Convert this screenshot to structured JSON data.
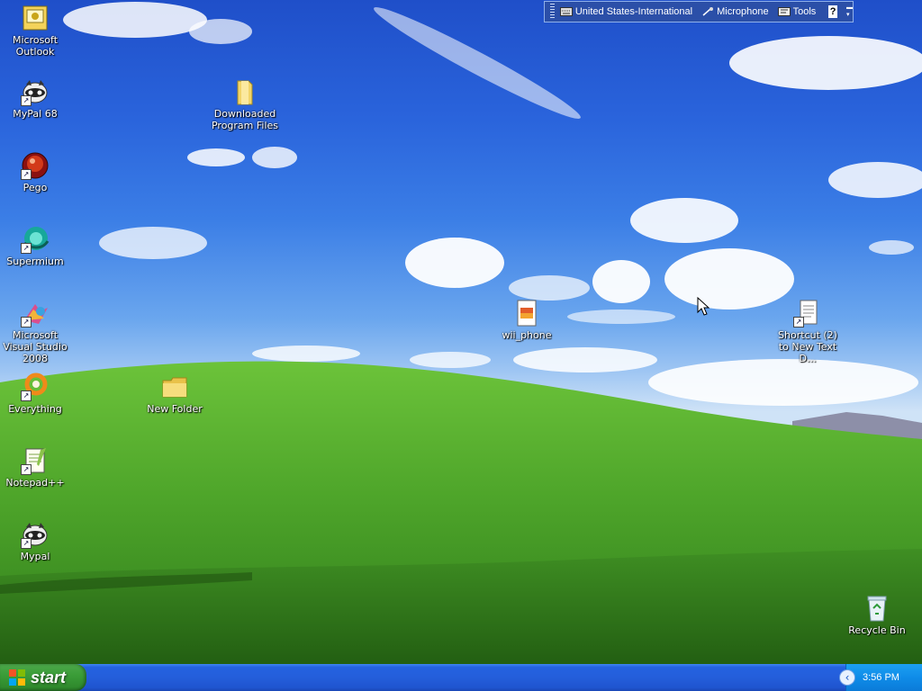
{
  "desktop": {
    "icons": [
      {
        "label": "Microsoft Outlook",
        "icon": "outlook-icon",
        "shortcut": false
      },
      {
        "label": "MyPal 68",
        "icon": "mypal-icon",
        "shortcut": true
      },
      {
        "label": "Pego",
        "icon": "pego-icon",
        "shortcut": true
      },
      {
        "label": "Supermium",
        "icon": "supermium-icon",
        "shortcut": true
      },
      {
        "label": "Microsoft Visual Studio 2008",
        "icon": "visual-studio-icon",
        "shortcut": true
      },
      {
        "label": "Everything",
        "icon": "everything-icon",
        "shortcut": true
      },
      {
        "label": "Notepad++",
        "icon": "notepadpp-icon",
        "shortcut": true
      },
      {
        "label": "Mypal",
        "icon": "mypal-icon",
        "shortcut": true
      },
      {
        "label": "Downloaded Program Files",
        "icon": "folder-icon",
        "shortcut": false
      },
      {
        "label": "New Folder",
        "icon": "folder-icon",
        "shortcut": false
      },
      {
        "label": "wii_phone",
        "icon": "image-file-icon",
        "shortcut": false
      },
      {
        "label": "Shortcut (2) to New Text D...",
        "icon": "text-document-icon",
        "shortcut": true
      },
      {
        "label": "Recycle Bin",
        "icon": "recycle-bin-icon",
        "shortcut": false
      }
    ]
  },
  "language_bar": {
    "language": "United States-International",
    "microphone": "Microphone",
    "tools": "Tools",
    "help": "?"
  },
  "taskbar": {
    "start_label": "start",
    "clock": "3:56 PM"
  },
  "colors": {
    "taskbar_blue": "#245edb",
    "start_green": "#3b9d38",
    "tray_blue": "#0f8ce8",
    "language_bar": "#2b4fa8"
  }
}
